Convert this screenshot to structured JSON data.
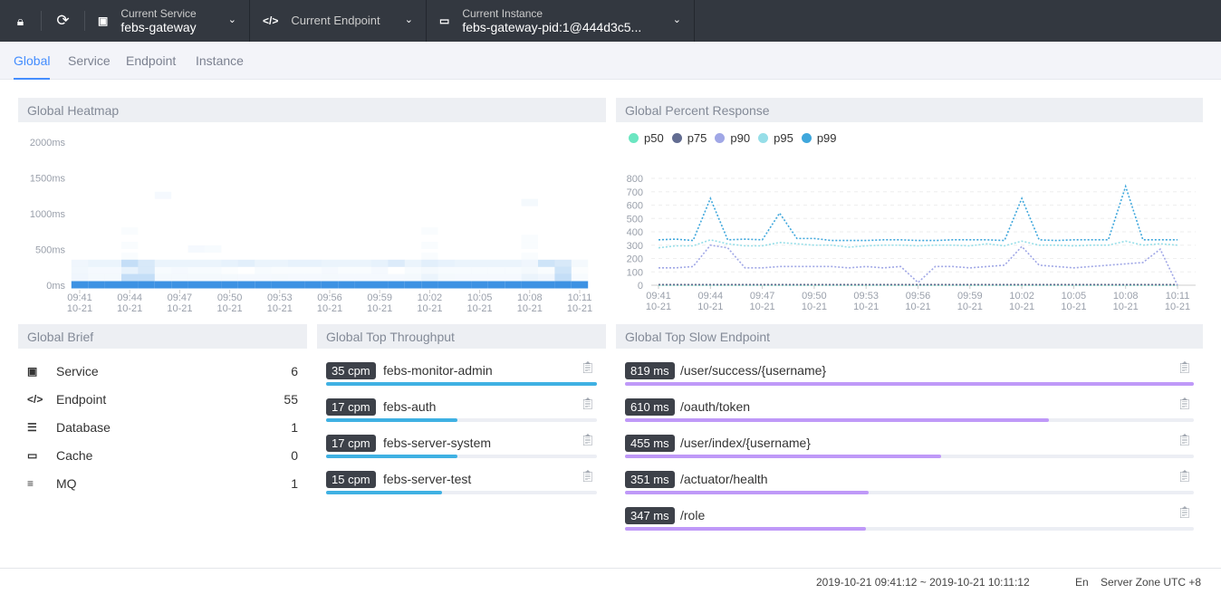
{
  "topbar": {
    "icons": [
      "lock-icon",
      "refresh-icon"
    ],
    "service": {
      "label": "Current Service",
      "value": "febs-gateway"
    },
    "endpoint": {
      "label": "Current Endpoint"
    },
    "instance": {
      "label": "Current Instance",
      "value": "febs-gateway-pid:1@444d3c5..."
    }
  },
  "tabs": [
    "Global",
    "Service",
    "Endpoint",
    "Instance"
  ],
  "heatmap": {
    "title": "Global Heatmap",
    "y_labels": [
      "2000ms",
      "1500ms",
      "1000ms",
      "500ms",
      "0ms"
    ],
    "color": "#3d92e3"
  },
  "percent": {
    "title": "Global Percent Response",
    "legend": [
      {
        "name": "p50",
        "color": "#6be6c1"
      },
      {
        "name": "p75",
        "color": "#626c91"
      },
      {
        "name": "p90",
        "color": "#a0a7e6"
      },
      {
        "name": "p95",
        "color": "#96dee8"
      },
      {
        "name": "p99",
        "color": "#3fa7dc"
      }
    ]
  },
  "chart_data": [
    {
      "type": "heatmap",
      "title": "Global Heatmap",
      "ylim": [
        0,
        2000
      ],
      "y_unit": "ms",
      "x": [
        "09:41",
        "09:42",
        "09:43",
        "09:44",
        "09:45",
        "09:46",
        "09:47",
        "09:48",
        "09:49",
        "09:50",
        "09:51",
        "09:52",
        "09:53",
        "09:54",
        "09:55",
        "09:56",
        "09:57",
        "09:58",
        "09:59",
        "10:00",
        "10:01",
        "10:02",
        "10:03",
        "10:04",
        "10:05",
        "10:06",
        "10:07",
        "10:08",
        "10:09",
        "10:10",
        "10:11"
      ],
      "x_tick_labels": [
        "09:41\n10-21",
        "09:44\n10-21",
        "09:47\n10-21",
        "09:50\n10-21",
        "09:53\n10-21",
        "09:56\n10-21",
        "09:59\n10-21",
        "10:02\n10-21",
        "10:05\n10-21",
        "10:08\n10-21",
        "10:11\n10-21"
      ],
      "rows": {
        "0": [
          1,
          1,
          1,
          1,
          1,
          1,
          1,
          1,
          1,
          1,
          1,
          1,
          1,
          1,
          1,
          1,
          1,
          1,
          1,
          1,
          1,
          1,
          1,
          1,
          1,
          1,
          1,
          1,
          1,
          1,
          1
        ],
        "100": [
          0.08,
          0.06,
          0.06,
          0.3,
          0.3,
          0.06,
          0.06,
          0.06,
          0.06,
          0.06,
          0.05,
          0.05,
          0.06,
          0.05,
          0.05,
          0.06,
          0.05,
          0.05,
          0.05,
          0.05,
          0.06,
          0.1,
          0.06,
          0.05,
          0.05,
          0.05,
          0.05,
          0.1,
          0.08,
          0.3,
          0.04
        ],
        "200": [
          0.07,
          0.05,
          0.05,
          0.12,
          0.2,
          0.04,
          0.05,
          0.04,
          0.04,
          0.02,
          0,
          0.04,
          0.03,
          0.03,
          0.03,
          0.05,
          0.03,
          0.03,
          0.05,
          0,
          0.04,
          0.06,
          0.04,
          0.04,
          0.04,
          0.04,
          0.04,
          0.06,
          0.03,
          0.25,
          0.02
        ],
        "300": [
          0.08,
          0.1,
          0.1,
          0.3,
          0.2,
          0.1,
          0.1,
          0.1,
          0.1,
          0.12,
          0.15,
          0.1,
          0.1,
          0.12,
          0.12,
          0.1,
          0.1,
          0.1,
          0.12,
          0.18,
          0.1,
          0.15,
          0.12,
          0.1,
          0.1,
          0.1,
          0.1,
          0.08,
          0.25,
          0.2,
          0.06
        ]
      },
      "sparse": [
        [
          3,
          400,
          0.03
        ],
        [
          3,
          550,
          0.03
        ],
        [
          3,
          750,
          0.03
        ],
        [
          7,
          500,
          0.05
        ],
        [
          8,
          500,
          0.04
        ],
        [
          21,
          400,
          0.03
        ],
        [
          21,
          550,
          0.03
        ],
        [
          21,
          750,
          0.03
        ],
        [
          27,
          400,
          0.03
        ],
        [
          27,
          550,
          0.03
        ],
        [
          27,
          650,
          0.03
        ],
        [
          27,
          1150,
          0.06
        ],
        [
          5,
          1250,
          0.05
        ]
      ]
    },
    {
      "type": "line",
      "title": "Global Percent Response",
      "ylim": [
        0,
        800
      ],
      "y_ticks": [
        0,
        100,
        200,
        300,
        400,
        500,
        600,
        700,
        800
      ],
      "grid": true,
      "legend": "top-left",
      "x": [
        "09:41",
        "09:42",
        "09:43",
        "09:44",
        "09:45",
        "09:46",
        "09:47",
        "09:48",
        "09:49",
        "09:50",
        "09:51",
        "09:52",
        "09:53",
        "09:54",
        "09:55",
        "09:56",
        "09:57",
        "09:58",
        "09:59",
        "10:00",
        "10:01",
        "10:02",
        "10:03",
        "10:04",
        "10:05",
        "10:06",
        "10:07",
        "10:08",
        "10:09",
        "10:10",
        "10:11"
      ],
      "x_tick_labels": [
        "09:41\n10-21",
        "09:44\n10-21",
        "09:47\n10-21",
        "09:50\n10-21",
        "09:53\n10-21",
        "09:56\n10-21",
        "09:59\n10-21",
        "10:02\n10-21",
        "10:05\n10-21",
        "10:08\n10-21",
        "10:11\n10-21"
      ],
      "series": [
        {
          "name": "p50",
          "values": [
            0,
            0,
            0,
            0,
            0,
            0,
            0,
            0,
            0,
            0,
            0,
            0,
            0,
            0,
            0,
            0,
            0,
            0,
            0,
            0,
            0,
            0,
            0,
            0,
            0,
            0,
            0,
            0,
            0,
            0,
            0
          ]
        },
        {
          "name": "p75",
          "values": [
            5,
            5,
            5,
            5,
            5,
            5,
            5,
            5,
            5,
            5,
            5,
            5,
            5,
            5,
            5,
            5,
            5,
            5,
            5,
            5,
            5,
            5,
            5,
            5,
            5,
            5,
            5,
            5,
            5,
            5,
            5
          ]
        },
        {
          "name": "p90",
          "values": [
            130,
            130,
            140,
            300,
            280,
            130,
            130,
            140,
            140,
            140,
            140,
            130,
            140,
            130,
            140,
            20,
            140,
            140,
            130,
            140,
            150,
            290,
            150,
            140,
            130,
            140,
            150,
            160,
            170,
            270,
            0
          ]
        },
        {
          "name": "p95",
          "values": [
            280,
            295,
            295,
            340,
            310,
            295,
            295,
            320,
            310,
            300,
            300,
            285,
            295,
            300,
            300,
            295,
            300,
            300,
            295,
            310,
            295,
            330,
            300,
            300,
            295,
            300,
            300,
            330,
            300,
            310,
            300
          ]
        },
        {
          "name": "p99",
          "values": [
            340,
            345,
            335,
            650,
            340,
            345,
            340,
            540,
            350,
            350,
            335,
            335,
            335,
            340,
            340,
            335,
            335,
            340,
            340,
            340,
            335,
            650,
            340,
            335,
            340,
            340,
            340,
            740,
            340,
            340,
            340
          ]
        }
      ]
    }
  ],
  "brief": {
    "title": "Global Brief",
    "items": [
      {
        "label": "Service",
        "value": "6",
        "icon": "service-icon",
        "glyph": "▣"
      },
      {
        "label": "Endpoint",
        "value": "55",
        "icon": "endpoint-icon",
        "glyph": "</>"
      },
      {
        "label": "Database",
        "value": "1",
        "icon": "database-icon",
        "glyph": "☰"
      },
      {
        "label": "Cache",
        "value": "0",
        "icon": "cache-icon",
        "glyph": "▭"
      },
      {
        "label": "MQ",
        "value": "1",
        "icon": "mq-icon",
        "glyph": "≡"
      }
    ]
  },
  "throughput": {
    "title": "Global Top Throughput",
    "color": "#3fb1e3",
    "items": [
      {
        "badge": "35 cpm",
        "name": "febs-monitor-admin",
        "value": 35
      },
      {
        "badge": "17 cpm",
        "name": "febs-auth",
        "value": 17
      },
      {
        "badge": "17 cpm",
        "name": "febs-server-system",
        "value": 17
      },
      {
        "badge": "15 cpm",
        "name": "febs-server-test",
        "value": 15
      }
    ]
  },
  "slow": {
    "title": "Global Top Slow Endpoint",
    "color": "#bf99f8",
    "items": [
      {
        "badge": "819 ms",
        "name": "/user/success/{username}",
        "value": 819
      },
      {
        "badge": "610 ms",
        "name": "/oauth/token",
        "value": 610
      },
      {
        "badge": "455 ms",
        "name": "/user/index/{username}",
        "value": 455
      },
      {
        "badge": "351 ms",
        "name": "/actuator/health",
        "value": 351
      },
      {
        "badge": "347 ms",
        "name": "/role",
        "value": 347
      }
    ]
  },
  "footer": {
    "range": "2019-10-21 09:41:12 ~ 2019-10-21 10:11:12",
    "lang": "En",
    "zone": "Server Zone UTC +8"
  }
}
